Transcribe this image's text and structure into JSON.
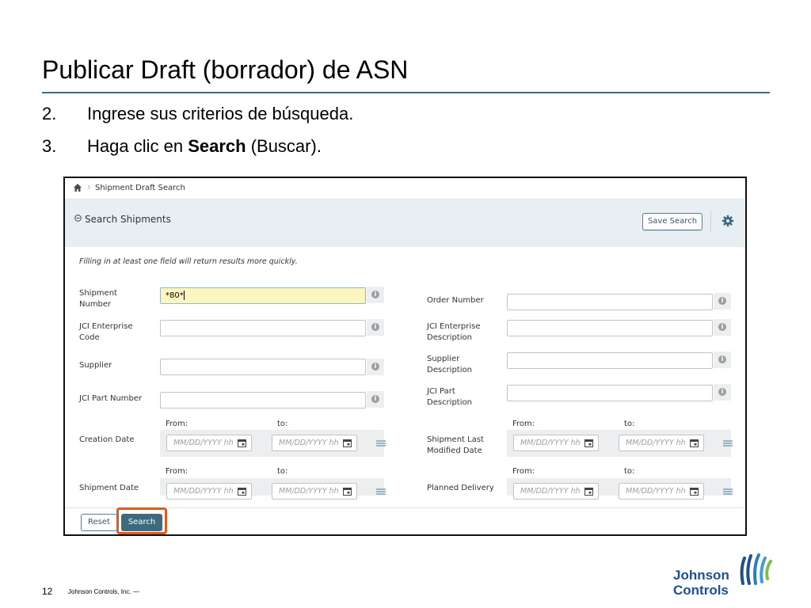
{
  "slide": {
    "title": "Publicar Draft (borrador) de ASN",
    "steps": [
      {
        "num": "2.",
        "text": "Ingrese sus criterios de búsqueda."
      },
      {
        "num": "3.",
        "pre": "Haga clic en ",
        "bold": "Search",
        "post": " (Buscar)."
      }
    ],
    "page_number": "12",
    "footer_text": "Johnson Controls, Inc. —",
    "logo": {
      "line1": "Johnson",
      "line2": "Controls"
    }
  },
  "app": {
    "breadcrumb": {
      "icon": "home-icon",
      "label": "Shipment Draft Search"
    },
    "panel": {
      "title": "Search Shipments",
      "collapse_icon": "minus-circle-icon",
      "save_label": "Save Search",
      "settings_icon": "gear-icon"
    },
    "hint": "Filling in at least one field will return results more quickly.",
    "left_fields": [
      {
        "label": "Shipment Number",
        "value": "*80*"
      },
      {
        "label": "JCI Enterprise Code",
        "value": ""
      },
      {
        "label": "Supplier",
        "value": ""
      },
      {
        "label": "JCI Part Number",
        "value": ""
      }
    ],
    "right_fields": [
      {
        "label": "Order Number",
        "value": ""
      },
      {
        "label": "JCI Enterprise Description",
        "value": ""
      },
      {
        "label": "Supplier Description",
        "value": ""
      },
      {
        "label": "JCI Part Description",
        "value": ""
      }
    ],
    "date_fields": {
      "from_label": "From:",
      "to_label": "to:",
      "placeholder": "MM/DD/YYYY hh",
      "creation": "Creation Date",
      "modified": "Shipment Last Modified Date",
      "shipment": "Shipment Date",
      "planned": "Planned Delivery"
    },
    "buttons": {
      "reset": "Reset",
      "search": "Search"
    },
    "colors": {
      "accent": "#3d6a7d",
      "highlight": "#e2591f",
      "active_input": "#fbf6c0",
      "panel_header": "#e7eff2"
    }
  }
}
